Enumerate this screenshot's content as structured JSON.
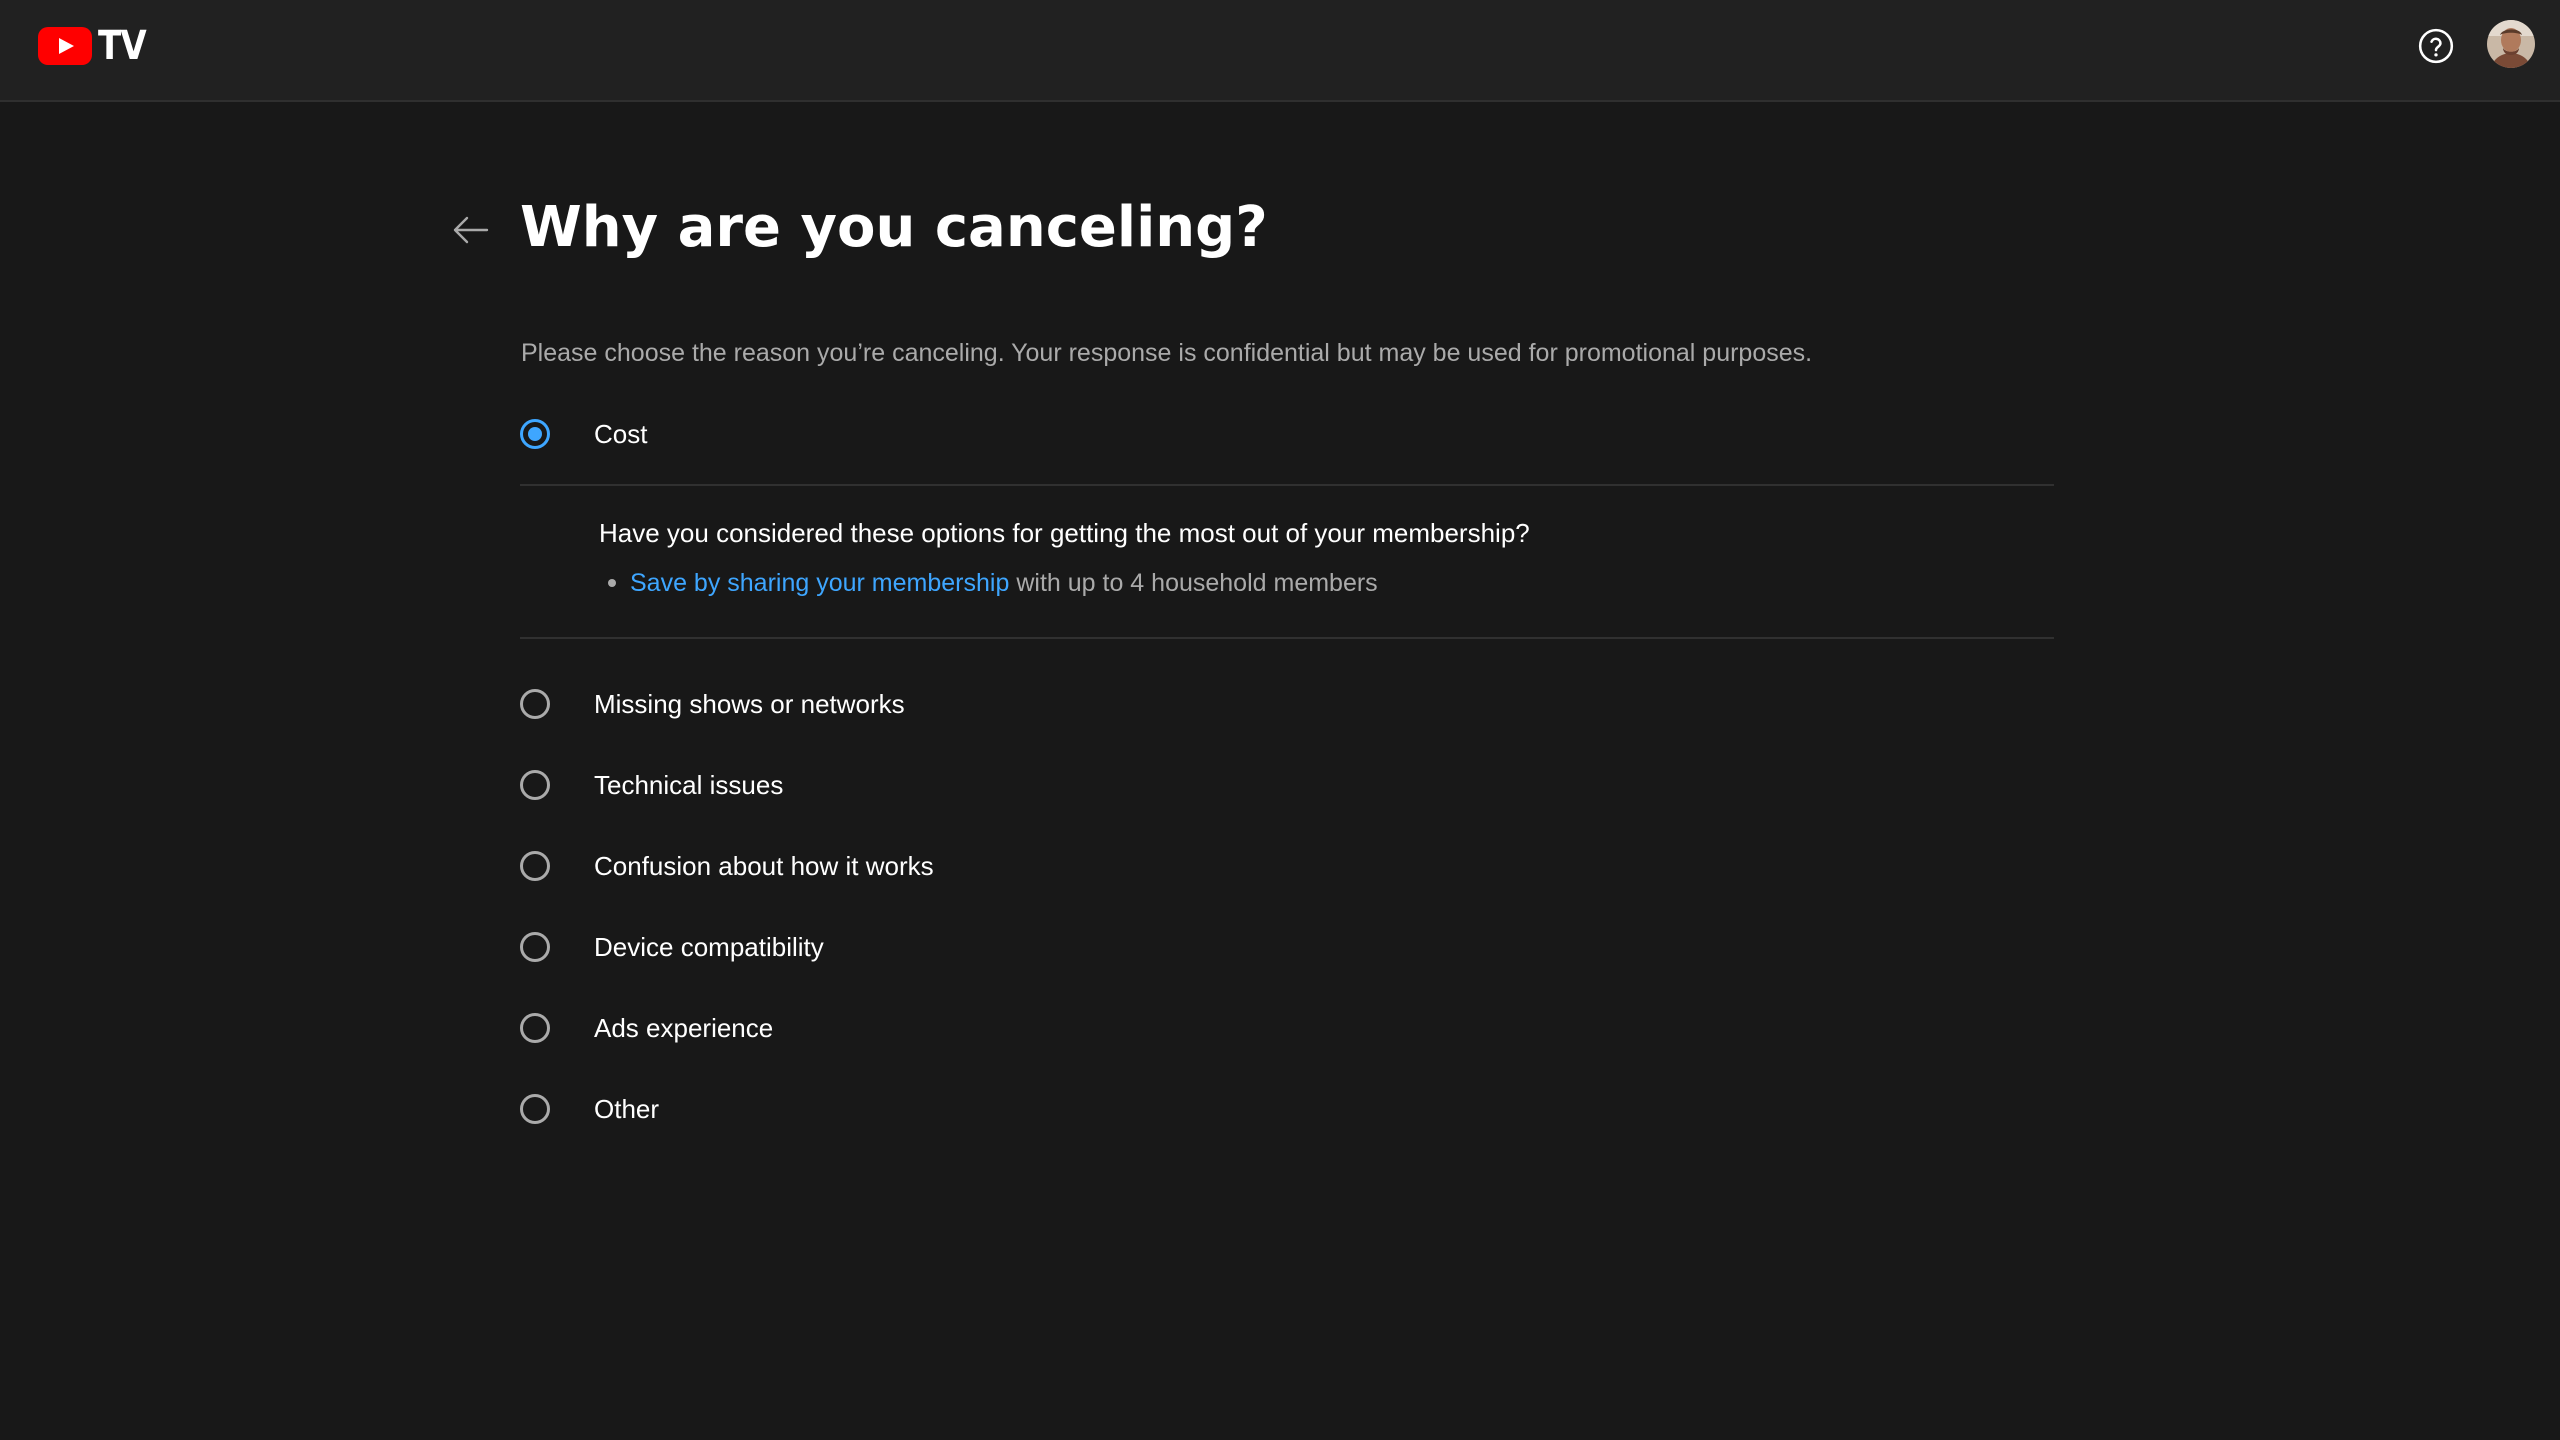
{
  "header": {
    "logo_text": "TV",
    "logo_icon": "youtube-play-icon",
    "help_icon": "help-circle-icon",
    "avatar_icon": "user-avatar"
  },
  "page": {
    "back_icon": "arrow-left-icon",
    "title": "Why are you canceling?",
    "subtitle": "Please choose the reason you’re canceling. Your response is confidential but may be used for promotional purposes."
  },
  "options": [
    {
      "label": "Cost",
      "selected": true
    },
    {
      "label": "Missing shows or networks",
      "selected": false
    },
    {
      "label": "Technical issues",
      "selected": false
    },
    {
      "label": "Confusion about how it works",
      "selected": false
    },
    {
      "label": "Device compatibility",
      "selected": false
    },
    {
      "label": "Ads experience",
      "selected": false
    },
    {
      "label": "Other",
      "selected": false
    }
  ],
  "cost_tip": {
    "heading": "Have you considered these options for getting the most out of your membership?",
    "link_text": "Save by sharing your membership",
    "rest_text": "with up to 4 household members"
  },
  "colors": {
    "background": "#181818",
    "header_bg": "#212121",
    "accent": "#3ea6ff",
    "brand_red": "#ff0000",
    "secondary_text": "#aaaaaa"
  }
}
